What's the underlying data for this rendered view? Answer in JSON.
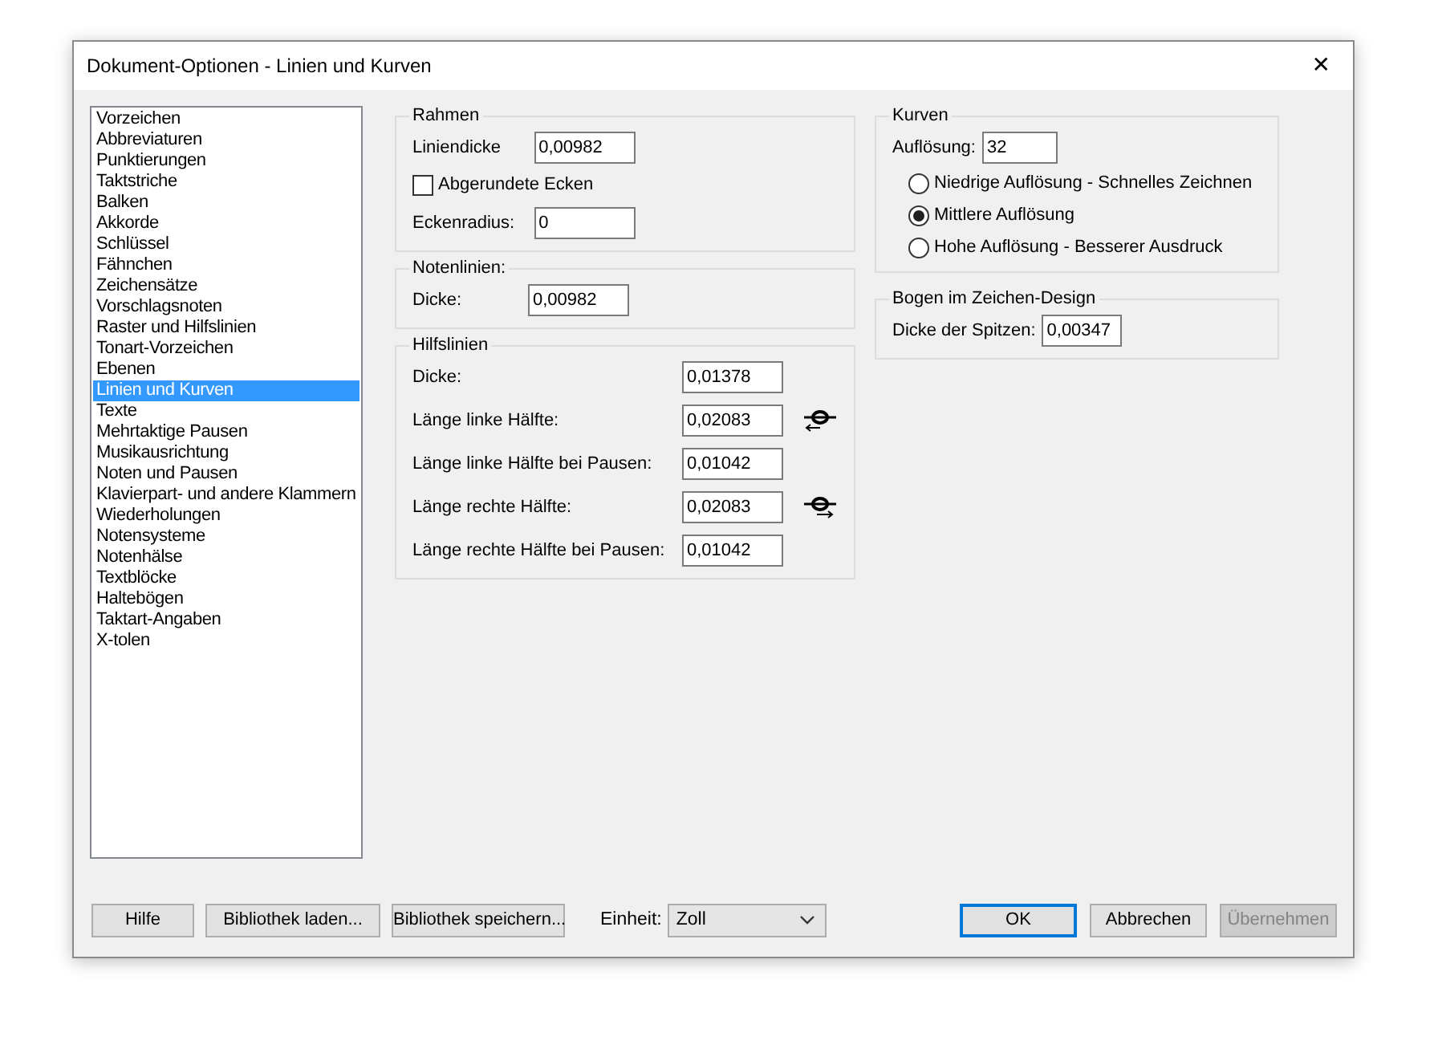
{
  "window": {
    "title": "Dokument-Optionen - Linien und Kurven",
    "close": "✕"
  },
  "categories": [
    {
      "label": "Vorzeichen",
      "selected": false
    },
    {
      "label": "Abbreviaturen",
      "selected": false
    },
    {
      "label": "Punktierungen",
      "selected": false
    },
    {
      "label": "Taktstriche",
      "selected": false
    },
    {
      "label": "Balken",
      "selected": false
    },
    {
      "label": "Akkorde",
      "selected": false
    },
    {
      "label": "Schlüssel",
      "selected": false
    },
    {
      "label": "Fähnchen",
      "selected": false
    },
    {
      "label": "Zeichensätze",
      "selected": false
    },
    {
      "label": "Vorschlagsnoten",
      "selected": false
    },
    {
      "label": "Raster und Hilfslinien",
      "selected": false
    },
    {
      "label": "Tonart-Vorzeichen",
      "selected": false
    },
    {
      "label": "Ebenen",
      "selected": false
    },
    {
      "label": "Linien und Kurven",
      "selected": true
    },
    {
      "label": "Texte",
      "selected": false
    },
    {
      "label": "Mehrtaktige Pausen",
      "selected": false
    },
    {
      "label": "Musikausrichtung",
      "selected": false
    },
    {
      "label": "Noten und Pausen",
      "selected": false
    },
    {
      "label": "Klavierpart- und andere Klammern",
      "selected": false
    },
    {
      "label": "Wiederholungen",
      "selected": false
    },
    {
      "label": "Notensysteme",
      "selected": false
    },
    {
      "label": "Notenhälse",
      "selected": false
    },
    {
      "label": "Textblöcke",
      "selected": false
    },
    {
      "label": "Haltebögen",
      "selected": false
    },
    {
      "label": "Taktart-Angaben",
      "selected": false
    },
    {
      "label": "X-tolen",
      "selected": false
    }
  ],
  "left_groups": [
    {
      "title": "Rahmen",
      "rows": [
        {
          "kind": "field",
          "label": "Liniendicke",
          "value": "0,00982"
        },
        {
          "kind": "checkbox",
          "label": "Abgerundete Ecken",
          "checked": false
        },
        {
          "kind": "field",
          "label": "Eckenradius:",
          "value": "0"
        }
      ]
    },
    {
      "title": "Notenlinien:",
      "rows": [
        {
          "kind": "field",
          "label": "Dicke:",
          "value": "0,00982"
        }
      ]
    },
    {
      "title": "Hilfslinien",
      "rows": [
        {
          "kind": "field",
          "label": "Dicke:",
          "value": "0,01378"
        },
        {
          "kind": "field_handle_left",
          "label": "Länge linke Hälfte:",
          "value": "0,02083"
        },
        {
          "kind": "field",
          "label": "Länge linke Hälfte bei Pausen:",
          "value": "0,01042"
        },
        {
          "kind": "field_handle_right",
          "label": "Länge rechte Hälfte:",
          "value": "0,02083"
        },
        {
          "kind": "field",
          "label": "Länge rechte Hälfte bei Pausen:",
          "value": "0,01042"
        }
      ]
    }
  ],
  "right_groups": [
    {
      "title": "Kurven",
      "rows": [
        {
          "kind": "field",
          "label": "Auflösung:",
          "value": "32"
        },
        {
          "kind": "radio",
          "label": "Niedrige Auflösung - Schnelles Zeichnen",
          "selected": false
        },
        {
          "kind": "radio",
          "label": "Mittlere Auflösung",
          "selected": true
        },
        {
          "kind": "radio",
          "label": "Hohe Auflösung - Besserer Ausdruck",
          "selected": false
        }
      ]
    },
    {
      "title": "Bogen im Zeichen-Design",
      "rows": [
        {
          "kind": "field",
          "label": "Dicke der Spitzen:",
          "value": "0,00347"
        }
      ]
    }
  ],
  "footer": {
    "left_buttons": [
      {
        "label": "Hilfe",
        "disabled": false
      },
      {
        "label": "Bibliothek laden...",
        "disabled": false
      },
      {
        "label": "Bibliothek speichern...",
        "disabled": false
      }
    ],
    "unit": {
      "label": "Einheit:",
      "value": "Zoll"
    },
    "right_buttons": [
      {
        "label": "OK",
        "disabled": false,
        "default": true
      },
      {
        "label": "Abbrechen",
        "disabled": false,
        "default": false
      },
      {
        "label": "Übernehmen",
        "disabled": true,
        "default": false
      }
    ]
  }
}
